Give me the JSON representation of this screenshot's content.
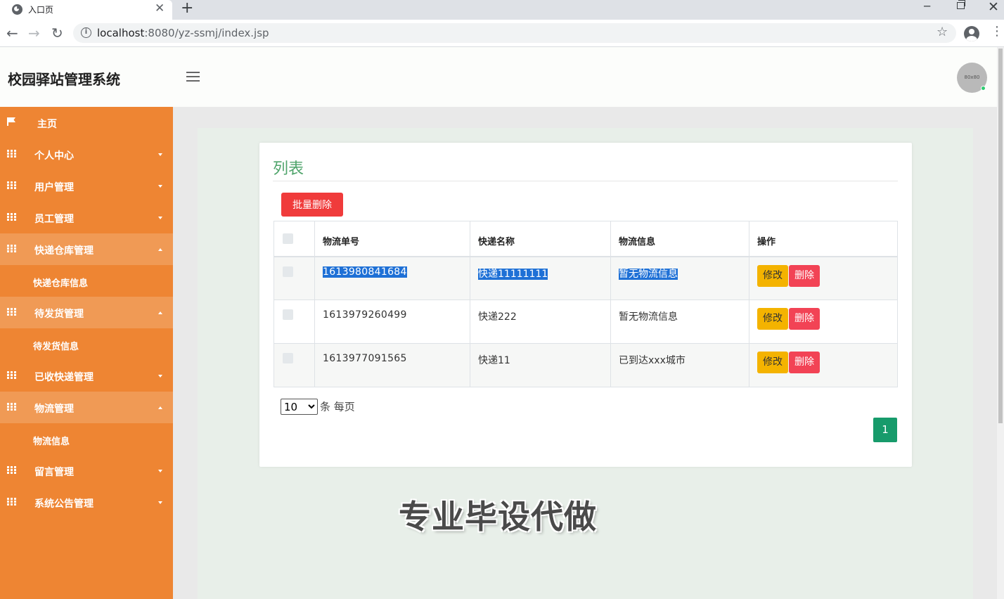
{
  "browser": {
    "tab_title": "入口页",
    "url_host": "localhost",
    "url_rest": ":8080/yz-ssmj/index.jsp"
  },
  "header": {
    "brand": "校园驿站管理系统",
    "avatar_text": "80x80"
  },
  "sidebar": {
    "items": [
      {
        "label": "主页"
      },
      {
        "label": "个人中心"
      },
      {
        "label": "用户管理"
      },
      {
        "label": "员工管理"
      },
      {
        "label": "快递仓库管理"
      },
      {
        "label": "快递仓库信息"
      },
      {
        "label": "待发货管理"
      },
      {
        "label": "待发货信息"
      },
      {
        "label": "已收快递管理"
      },
      {
        "label": "物流管理"
      },
      {
        "label": "物流信息"
      },
      {
        "label": "留言管理"
      },
      {
        "label": "系统公告管理"
      }
    ]
  },
  "card": {
    "title": "列表",
    "batch_delete": "批量删除"
  },
  "table": {
    "headers": [
      "物流单号",
      "快递名称",
      "物流信息",
      "操作"
    ],
    "rows": [
      {
        "no": "1613980841684",
        "name": "快递11111111",
        "info": "暂无物流信息"
      },
      {
        "no": "1613979260499",
        "name": "快递222",
        "info": "暂无物流信息"
      },
      {
        "no": "1613977091565",
        "name": "快递11",
        "info": "已到达xxx城市"
      }
    ],
    "edit_label": "修改",
    "delete_label": "删除"
  },
  "pagination": {
    "page_size": "10",
    "page_size_suffix": "条 每页",
    "current_page": "1"
  },
  "watermark": "专业毕设代做",
  "colors": {
    "sidebar": "#ee8533",
    "title_green": "#4fa46b",
    "danger": "#f03b3b",
    "warning": "#f4b300",
    "page_active": "#179b6b"
  }
}
